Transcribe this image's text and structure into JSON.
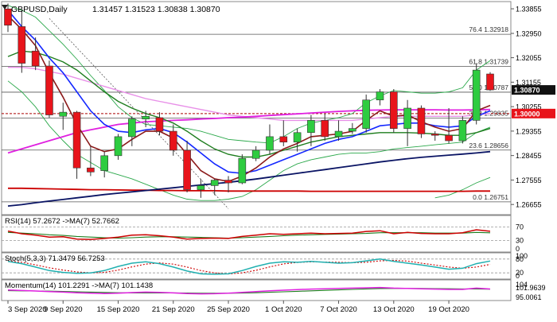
{
  "header": {
    "symbol": "GBPUSD,Daily",
    "ohlc": "1.31457 1.31523 1.30838 1.30870"
  },
  "colors": {
    "bull": "#2ecc40",
    "bear": "#e8141b",
    "ema_fast": "#8b1a1a",
    "ema_mid": "#1428ff",
    "ma_green": "#1e7d1e",
    "ma_pink": "#e020e0",
    "ma_violet": "#e890e8",
    "ma_red": "#cc0000",
    "ma_navy": "#0a1464",
    "bb": "#2aa84a",
    "fib": "#555555",
    "price_box": "#111111",
    "hline_box": "#e8141b",
    "rsi_main": "#cc0000",
    "rsi_sig": "#1e7d1e",
    "stoch_main": "#20b0b0",
    "stoch_sig": "#cc0000",
    "mom_main": "#e020e0",
    "mom_sig": "#1e7d1e"
  },
  "chart_data": {
    "type": "candlestick",
    "ylim": [
      1.2628,
      1.3412
    ],
    "y_tick_labels": [
      "1.33855",
      "1.32950",
      "1.32055",
      "1.31155",
      "1.30255",
      "1.29355",
      "1.28455",
      "1.27555",
      "1.26655"
    ],
    "y_ticks": [
      1.33855,
      1.3295,
      1.32055,
      1.31155,
      1.30255,
      1.29355,
      1.28455,
      1.27555,
      1.26655
    ],
    "x_tick_labels": [
      {
        "label": "3 Sep 2020",
        "index": 0
      },
      {
        "label": "9 Sep 2020",
        "index": 4
      },
      {
        "label": "15 Sep 2020",
        "index": 8
      },
      {
        "label": "21 Sep 2020",
        "index": 12
      },
      {
        "label": "25 Sep 2020",
        "index": 16
      },
      {
        "label": "1 Oct 2020",
        "index": 20
      },
      {
        "label": "7 Oct 2020",
        "index": 24
      },
      {
        "label": "13 Oct 2020",
        "index": 28
      },
      {
        "label": "19 Oct 2020",
        "index": 32
      }
    ],
    "candles": [
      {
        "o": 1.3385,
        "h": 1.3405,
        "l": 1.33,
        "c": 1.3325
      },
      {
        "o": 1.332,
        "h": 1.338,
        "l": 1.315,
        "c": 1.3185
      },
      {
        "o": 1.323,
        "h": 1.328,
        "l": 1.316,
        "c": 1.3175
      },
      {
        "o": 1.3175,
        "h": 1.3195,
        "l": 1.2985,
        "c": 1.2995
      },
      {
        "o": 1.299,
        "h": 1.304,
        "l": 1.294,
        "c": 1.3005
      },
      {
        "o": 1.3005,
        "h": 1.301,
        "l": 1.276,
        "c": 1.28
      },
      {
        "o": 1.28,
        "h": 1.288,
        "l": 1.277,
        "c": 1.2785
      },
      {
        "o": 1.279,
        "h": 1.286,
        "l": 1.2765,
        "c": 1.2845
      },
      {
        "o": 1.2845,
        "h": 1.2925,
        "l": 1.283,
        "c": 1.2915
      },
      {
        "o": 1.2915,
        "h": 1.299,
        "l": 1.288,
        "c": 1.298
      },
      {
        "o": 1.298,
        "h": 1.301,
        "l": 1.295,
        "c": 1.299
      },
      {
        "o": 1.2985,
        "h": 1.3005,
        "l": 1.292,
        "c": 1.2935
      },
      {
        "o": 1.2935,
        "h": 1.296,
        "l": 1.2845,
        "c": 1.2865
      },
      {
        "o": 1.2865,
        "h": 1.29,
        "l": 1.271,
        "c": 1.272
      },
      {
        "o": 1.272,
        "h": 1.276,
        "l": 1.269,
        "c": 1.2735
      },
      {
        "o": 1.2735,
        "h": 1.276,
        "l": 1.27,
        "c": 1.2755
      },
      {
        "o": 1.2755,
        "h": 1.277,
        "l": 1.271,
        "c": 1.2745
      },
      {
        "o": 1.2745,
        "h": 1.285,
        "l": 1.274,
        "c": 1.2835
      },
      {
        "o": 1.2835,
        "h": 1.288,
        "l": 1.2825,
        "c": 1.2865
      },
      {
        "o": 1.2865,
        "h": 1.296,
        "l": 1.285,
        "c": 1.2915
      },
      {
        "o": 1.2915,
        "h": 1.2975,
        "l": 1.288,
        "c": 1.2895
      },
      {
        "o": 1.2895,
        "h": 1.2945,
        "l": 1.286,
        "c": 1.293
      },
      {
        "o": 1.293,
        "h": 1.2995,
        "l": 1.288,
        "c": 1.2975
      },
      {
        "o": 1.2975,
        "h": 1.3,
        "l": 1.29,
        "c": 1.2915
      },
      {
        "o": 1.2915,
        "h": 1.2975,
        "l": 1.29,
        "c": 1.2935
      },
      {
        "o": 1.2935,
        "h": 1.2965,
        "l": 1.2925,
        "c": 1.2945
      },
      {
        "o": 1.2945,
        "h": 1.307,
        "l": 1.293,
        "c": 1.305
      },
      {
        "o": 1.305,
        "h": 1.309,
        "l": 1.303,
        "c": 1.308
      },
      {
        "o": 1.308,
        "h": 1.309,
        "l": 1.293,
        "c": 1.2945
      },
      {
        "o": 1.2945,
        "h": 1.305,
        "l": 1.288,
        "c": 1.302
      },
      {
        "o": 1.302,
        "h": 1.303,
        "l": 1.291,
        "c": 1.2925
      },
      {
        "o": 1.2925,
        "h": 1.2935,
        "l": 1.29,
        "c": 1.292
      },
      {
        "o": 1.292,
        "h": 1.302,
        "l": 1.289,
        "c": 1.29
      },
      {
        "o": 1.29,
        "h": 1.299,
        "l": 1.289,
        "c": 1.2975
      },
      {
        "o": 1.2975,
        "h": 1.3185,
        "l": 1.296,
        "c": 1.316
      },
      {
        "o": 1.31457,
        "h": 1.31523,
        "l": 1.30838,
        "c": 1.3087
      }
    ],
    "overlays": [
      {
        "key": "bb",
        "values": [
          1.3398,
          1.338,
          1.3355,
          1.3305,
          1.3255,
          1.32,
          1.314,
          1.3085,
          1.3025,
          1.2985,
          1.296,
          1.2955,
          1.295,
          1.2945,
          1.2935,
          1.292,
          1.2905,
          1.29,
          1.2895,
          1.2892,
          1.2915,
          1.2945,
          1.2965,
          1.2975,
          1.2985,
          1.3,
          1.304,
          1.3065,
          1.3085,
          1.308,
          1.3075,
          1.3075,
          1.308,
          1.3095,
          1.316,
          1.3195
        ]
      },
      {
        "key": "bb",
        "values": [
          1.312,
          1.308,
          1.3025,
          1.2955,
          1.29,
          1.285,
          1.282,
          1.279,
          1.2775,
          1.276,
          1.274,
          1.272,
          1.27,
          1.2685,
          1.268,
          1.268,
          1.2685,
          1.2695,
          1.272,
          1.2755,
          1.279,
          1.2815,
          1.283,
          1.284,
          1.285,
          1.2855,
          1.2855,
          1.286,
          1.287,
          1.2875,
          1.288,
          1.2885,
          1.289,
          1.2895,
          1.293,
          1.295
        ]
      },
      {
        "key": "bb",
        "values": [
          null,
          null,
          null,
          null,
          null,
          null,
          null,
          null,
          null,
          null,
          null,
          null,
          null,
          null,
          null,
          null,
          null,
          null,
          null,
          null,
          null,
          null,
          null,
          null,
          null,
          null,
          null,
          null,
          null,
          null,
          null,
          1.269,
          1.27,
          1.272,
          1.2745,
          1.2765
        ]
      },
      {
        "key": "ma_violet",
        "values": [
          1.317,
          1.317,
          1.3165,
          1.3155,
          1.3145,
          1.313,
          1.3115,
          1.31,
          1.3085,
          1.307,
          1.3055,
          1.3045,
          1.3035,
          1.3025,
          1.3015,
          1.3005,
          1.2995,
          1.299,
          1.2985,
          1.298,
          1.2975,
          1.2975,
          1.2975,
          1.2975,
          1.2975,
          1.2975,
          1.298,
          1.2985,
          1.299,
          1.299,
          1.299,
          1.299,
          1.299,
          1.299,
          1.2995,
          1.3
        ]
      },
      {
        "key": "ma_pink",
        "values": [
          1.2855,
          1.287,
          1.2885,
          1.29,
          1.2915,
          1.293,
          1.294,
          1.295,
          1.296,
          1.2965,
          1.297,
          1.2972,
          1.2975,
          1.2977,
          1.298,
          1.2982,
          1.2985,
          1.2987,
          1.299,
          1.2993,
          1.2996,
          1.2999,
          1.3002,
          1.3005,
          1.3008,
          1.301,
          1.3012,
          1.3013,
          1.3014,
          1.3014,
          1.3014,
          1.3014,
          1.3013,
          1.3013,
          1.3014,
          1.3015
        ]
      },
      {
        "key": "ma_red",
        "values": [
          1.2725,
          1.2725,
          1.2724,
          1.2723,
          1.2722,
          1.2721,
          1.272,
          1.272,
          1.2719,
          1.2718,
          1.2718,
          1.2717,
          1.2717,
          1.2716,
          1.2716,
          1.2716,
          1.2715,
          1.2715,
          1.2715,
          1.2715,
          1.2715,
          1.2715,
          1.2714,
          1.2714,
          1.2714,
          1.2714,
          1.2714,
          1.2714,
          1.2714,
          1.2714,
          1.2714,
          1.2714,
          1.2714,
          1.2714,
          1.2715,
          1.2715
        ]
      },
      {
        "key": "ma_navy",
        "values": [
          1.266,
          1.2665,
          1.2672,
          1.2678,
          1.2684,
          1.269,
          1.2696,
          1.2702,
          1.2707,
          1.2712,
          1.2717,
          1.2722,
          1.2727,
          1.2732,
          1.2737,
          1.2742,
          1.2747,
          1.2753,
          1.2759,
          1.2766,
          1.2773,
          1.278,
          1.2787,
          1.2794,
          1.2801,
          1.2808,
          1.2815,
          1.2822,
          1.2828,
          1.2834,
          1.2839,
          1.2843,
          1.2847,
          1.2851,
          1.2855,
          1.286
        ]
      },
      {
        "key": "ma_green",
        "values": [
          1.321,
          1.323,
          1.3225,
          1.321,
          1.319,
          1.316,
          1.312,
          1.308,
          1.3045,
          1.302,
          1.3,
          1.2985,
          1.2965,
          1.2935,
          1.29,
          1.287,
          1.285,
          1.284,
          1.284,
          1.285,
          1.2865,
          1.288,
          1.2895,
          1.2905,
          1.2915,
          1.292,
          1.2925,
          1.293,
          1.293,
          1.293,
          1.2928,
          1.2925,
          1.292,
          1.292,
          1.293,
          1.2945
        ]
      },
      {
        "key": "ema_mid",
        "values": [
          1.338,
          1.332,
          1.327,
          1.3205,
          1.315,
          1.308,
          1.301,
          1.296,
          1.2935,
          1.293,
          1.294,
          1.2945,
          1.293,
          1.2895,
          1.2855,
          1.2815,
          1.2785,
          1.278,
          1.279,
          1.281,
          1.283,
          1.285,
          1.287,
          1.289,
          1.2905,
          1.2915,
          1.2935,
          1.2955,
          1.296,
          1.2965,
          1.2965,
          1.2955,
          1.295,
          1.2955,
          1.299,
          1.301
        ]
      },
      {
        "key": "ema_fast",
        "values": [
          1.336,
          1.331,
          1.325,
          1.315,
          1.306,
          1.296,
          1.288,
          1.286,
          1.287,
          1.2905,
          1.2935,
          1.2935,
          1.291,
          1.285,
          1.279,
          1.276,
          1.275,
          1.277,
          1.28,
          1.284,
          1.287,
          1.289,
          1.2915,
          1.292,
          1.2925,
          1.2935,
          1.2975,
          1.301,
          1.299,
          1.2995,
          1.297,
          1.295,
          1.2935,
          1.2945,
          1.301,
          1.303
        ]
      }
    ],
    "fib_levels": [
      {
        "label": "76.4 1.32918",
        "value": 1.32918
      },
      {
        "label": "61.8 1.31739",
        "value": 1.31739
      },
      {
        "label": "50.0 1.30787",
        "value": 1.30787
      },
      {
        "label": "38.2 1.29835",
        "value": 1.29835
      },
      {
        "label": "23.6 1.28656",
        "value": 1.28656
      },
      {
        "label": "0.0 1.26751",
        "value": 1.26751
      }
    ],
    "horizontal_line": {
      "value": 1.3,
      "label": "1.30000"
    },
    "current_price": {
      "value": 1.3087,
      "label": "1.30870"
    },
    "trendline": {
      "from": {
        "i": 3,
        "v": 1.335
      },
      "to": {
        "i": 16,
        "v": 1.265
      }
    },
    "subplots": [
      {
        "key": "rsi",
        "legend": "RSI(14) 57.2672 ->MA(7) 52.7662",
        "ylim": [
          0,
          100
        ],
        "ticks": [
          {
            "label": "70",
            "value": 70
          },
          {
            "label": "30",
            "value": 30
          },
          {
            "label": "0",
            "value": 0
          }
        ],
        "levels": [
          70,
          30
        ],
        "main": [
          58,
          50,
          46,
          40,
          41,
          34,
          33,
          36,
          40,
          46,
          47,
          44,
          40,
          34,
          36,
          37,
          36,
          42,
          46,
          50,
          48,
          50,
          52,
          50,
          51,
          52,
          57,
          59,
          50,
          54,
          51,
          50,
          50,
          53,
          62,
          57.2672
        ],
        "signal": [
          54,
          52,
          50,
          47,
          45,
          42,
          40,
          38,
          37,
          38,
          40,
          41,
          41,
          40,
          39,
          38,
          37,
          38,
          40,
          42,
          44,
          46,
          47,
          48,
          49,
          50,
          51,
          53,
          53,
          53,
          53,
          52,
          52,
          52,
          54,
          52.7662
        ]
      },
      {
        "key": "stoch",
        "legend": "Stoch(5,3,3) 71.3479 56.7253",
        "ylim": [
          0,
          100
        ],
        "ticks": [
          {
            "label": "100",
            "value": 100
          },
          {
            "label": "80",
            "value": 80
          },
          {
            "label": "20",
            "value": 20
          },
          {
            "label": "0",
            "value": 0
          }
        ],
        "levels": [
          80,
          20
        ],
        "main": [
          70,
          60,
          45,
          30,
          22,
          18,
          20,
          30,
          48,
          62,
          68,
          60,
          45,
          28,
          16,
          14,
          16,
          30,
          48,
          62,
          68,
          66,
          70,
          66,
          62,
          64,
          72,
          80,
          70,
          62,
          54,
          45,
          36,
          40,
          60,
          71.3479
        ],
        "signal": [
          72,
          66,
          55,
          42,
          32,
          24,
          20,
          22,
          32,
          46,
          58,
          63,
          58,
          45,
          30,
          20,
          15,
          20,
          31,
          46,
          59,
          65,
          68,
          67,
          66,
          64,
          66,
          72,
          74,
          71,
          62,
          54,
          45,
          40,
          45,
          56.7253
        ]
      },
      {
        "key": "mom",
        "legend": "Momentum(14) 101.2291 ->MA(7) 101.1438",
        "ylim": [
          95.0,
          106.0
        ],
        "ticks": [
          {
            "label": "104",
            "value": 104
          },
          {
            "label": "101.9639",
            "value": 101.9639
          },
          {
            "label": "95.0061",
            "value": 95.0061
          }
        ],
        "main": [
          100.6,
          100.3,
          100.0,
          99.6,
          99.3,
          98.9,
          98.6,
          98.4,
          98.6,
          99.0,
          99.3,
          99.1,
          98.8,
          98.4,
          98.2,
          98.3,
          98.6,
          99.1,
          99.6,
          100.1,
          100.5,
          100.9,
          101.2,
          101.4,
          101.6,
          101.8,
          102.0,
          102.2,
          101.8,
          101.6,
          101.4,
          101.2,
          101.0,
          101.0,
          101.8,
          101.2291
        ],
        "signal": [
          100.2,
          100.1,
          100.0,
          99.9,
          99.7,
          99.5,
          99.3,
          99.1,
          98.9,
          98.8,
          98.8,
          98.8,
          98.8,
          98.7,
          98.6,
          98.6,
          98.6,
          98.7,
          98.9,
          99.2,
          99.5,
          99.8,
          100.1,
          100.4,
          100.7,
          101.0,
          101.3,
          101.5,
          101.6,
          101.6,
          101.6,
          101.5,
          101.4,
          101.3,
          101.3,
          101.1438
        ]
      }
    ]
  }
}
